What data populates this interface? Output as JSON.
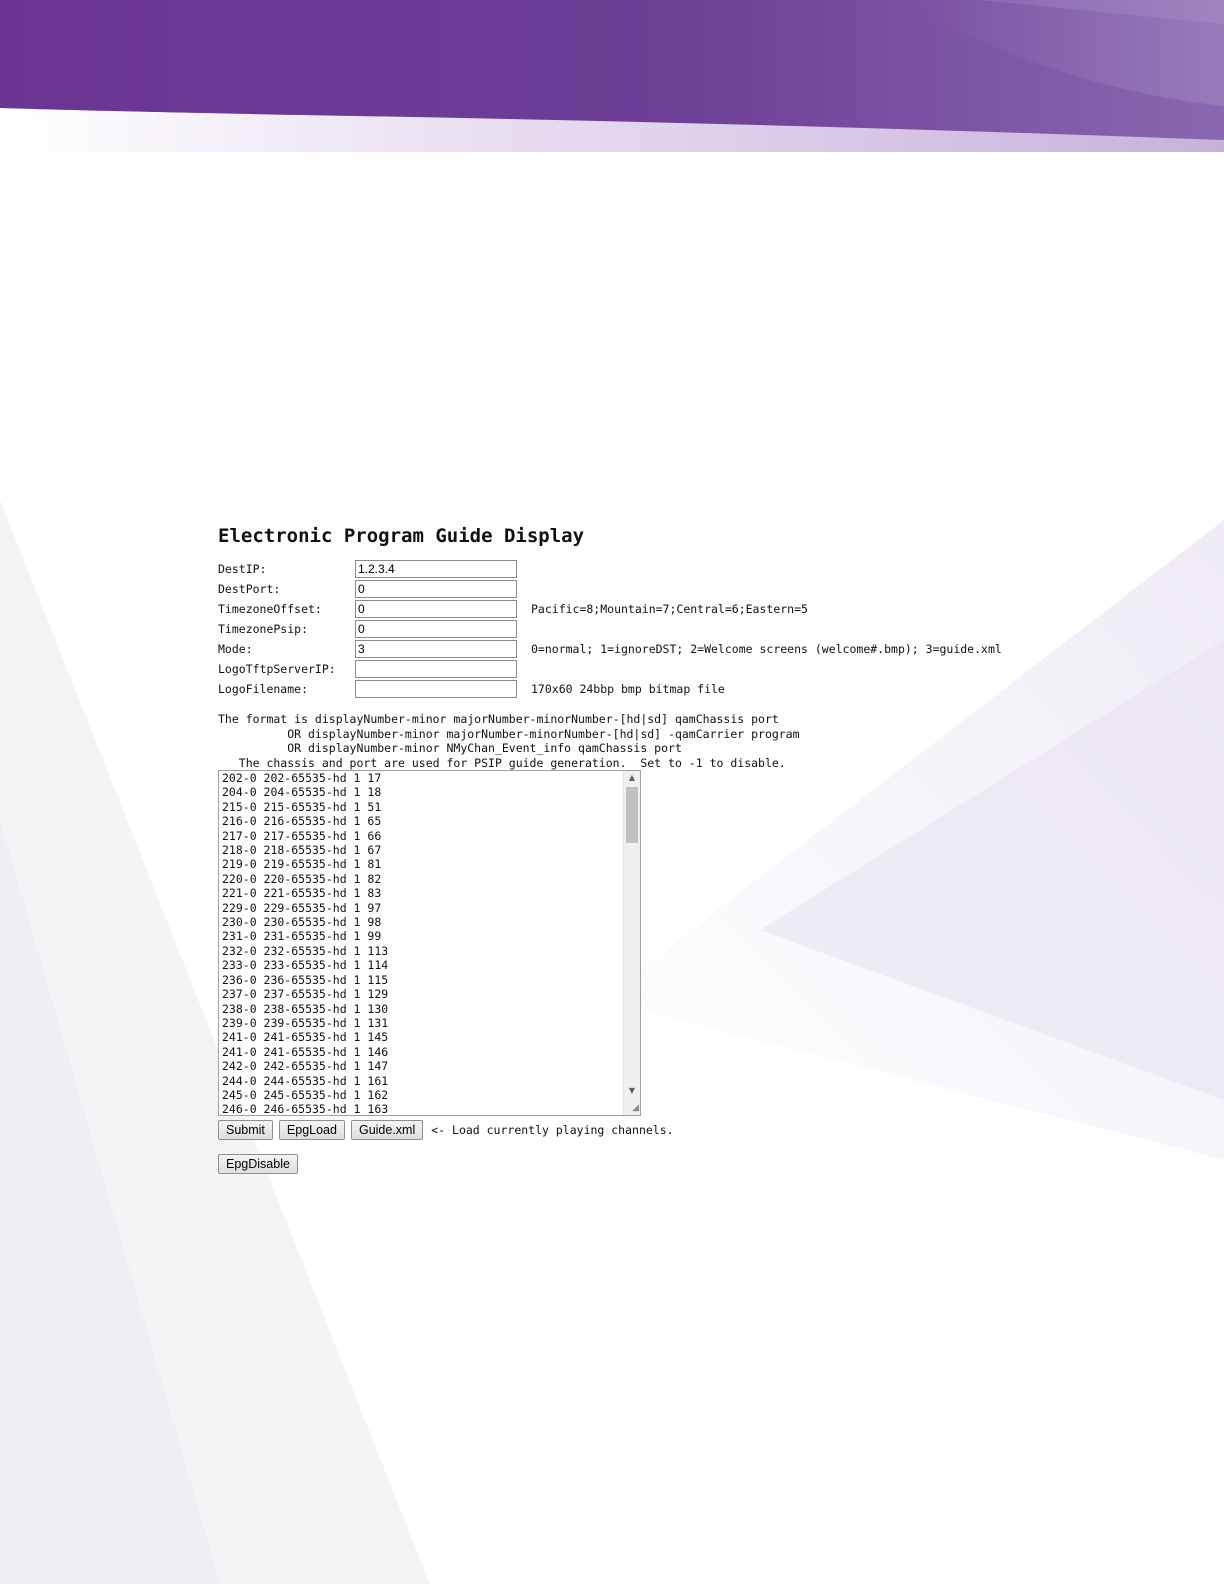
{
  "page": {
    "title": "Electronic Program Guide Display",
    "colors": {
      "header_purple": "#6a3a96",
      "header_purple_light": "#8a62b2",
      "accent_lavender": "#d9c8ea"
    }
  },
  "form": {
    "fields": [
      {
        "label": "DestIP:",
        "value": "1.2.3.4",
        "hint": ""
      },
      {
        "label": "DestPort:",
        "value": "0",
        "hint": ""
      },
      {
        "label": "TimezoneOffset:",
        "value": "0",
        "hint": "Pacific=8;Mountain=7;Central=6;Eastern=5"
      },
      {
        "label": "TimezonePsip:",
        "value": "0",
        "hint": ""
      },
      {
        "label": "Mode:",
        "value": "3",
        "hint": "0=normal; 1=ignoreDST; 2=Welcome screens (welcome#.bmp); 3=guide.xml"
      },
      {
        "label": "LogoTftpServerIP:",
        "value": "",
        "hint": ""
      },
      {
        "label": "LogoFilename:",
        "value": "",
        "hint": "170x60 24bbp bmp bitmap file"
      }
    ]
  },
  "format_help": {
    "line1": "The format is displayNumber-minor majorNumber-minorNumber-[hd|sd] qamChassis port",
    "line2": "          OR displayNumber-minor majorNumber-minorNumber-[hd|sd] -qamCarrier program",
    "line3": "          OR displayNumber-minor NMyChan_Event_info qamChassis port",
    "line4": "   The chassis and port are used for PSIP guide generation.  Set to -1 to disable."
  },
  "channel_list": {
    "value": "202-0 202-65535-hd 1 17\n204-0 204-65535-hd 1 18\n215-0 215-65535-hd 1 51\n216-0 216-65535-hd 1 65\n217-0 217-65535-hd 1 66\n218-0 218-65535-hd 1 67\n219-0 219-65535-hd 1 81\n220-0 220-65535-hd 1 82\n221-0 221-65535-hd 1 83\n229-0 229-65535-hd 1 97\n230-0 230-65535-hd 1 98\n231-0 231-65535-hd 1 99\n232-0 232-65535-hd 1 113\n233-0 233-65535-hd 1 114\n236-0 236-65535-hd 1 115\n237-0 237-65535-hd 1 129\n238-0 238-65535-hd 1 130\n239-0 239-65535-hd 1 131\n241-0 241-65535-hd 1 145\n241-0 241-65535-hd 1 146\n242-0 242-65535-hd 1 147\n244-0 244-65535-hd 1 161\n245-0 245-65535-hd 1 162\n246-0 246-65535-hd 1 163",
    "scroll_up_icon": "triangle-up",
    "scroll_down_icon": "triangle-down"
  },
  "buttons": {
    "submit": "Submit",
    "epgload": "EpgLoad",
    "guide_xml": "Guide.xml",
    "load_note": "<- Load currently playing channels.",
    "epgdisable": "EpgDisable"
  }
}
